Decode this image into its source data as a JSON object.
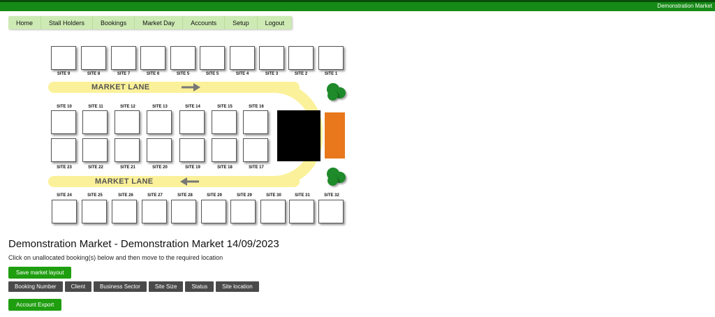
{
  "header": {
    "brand": "Demonstration Market"
  },
  "nav": [
    "Home",
    "Stall Holders",
    "Bookings",
    "Market Day",
    "Accounts",
    "Setup",
    "Logout"
  ],
  "map": {
    "lanes": [
      "MARKET LANE",
      "MARKET LANE"
    ],
    "row1": [
      "SITE 9",
      "SITE 8",
      "SITE 7",
      "SITE 6",
      "SITE 5",
      "SITE 5",
      "SITE 4",
      "SITE 3",
      "SITE 2",
      "SITE 1"
    ],
    "row2": [
      "SITE 10",
      "SITE 11",
      "SITE 12",
      "SITE 13",
      "SITE 14",
      "SITE 15",
      "SITE 16"
    ],
    "row3": [
      "SITE 23",
      "SITE 22",
      "SITE 21",
      "SITE 20",
      "SITE 19",
      "SITE 18",
      "SITE 17"
    ],
    "row4": [
      "SITE 24",
      "SITE 25",
      "SITE 26",
      "SITE 27",
      "SITE 28",
      "SITE 29",
      "SITE 29",
      "SITE 30",
      "SITE 31",
      "SITE 32"
    ]
  },
  "main": {
    "title": "Demonstration Market - Demonstration Market 14/09/2023",
    "instructions": "Click on unallocated booking(s) below and then move to the required location",
    "save_label": "Save market layout",
    "columns": [
      "Booking Number",
      "Client",
      "Business Sector",
      "Site Size",
      "Status",
      "Site location"
    ],
    "export_label": "Account Export"
  },
  "colors": {
    "brand_green": "#168a16",
    "nav_bg": "#cdeab4",
    "lane": "#fbf19a",
    "tree": "#1e8a2a",
    "orange_block": "#e8781b"
  }
}
